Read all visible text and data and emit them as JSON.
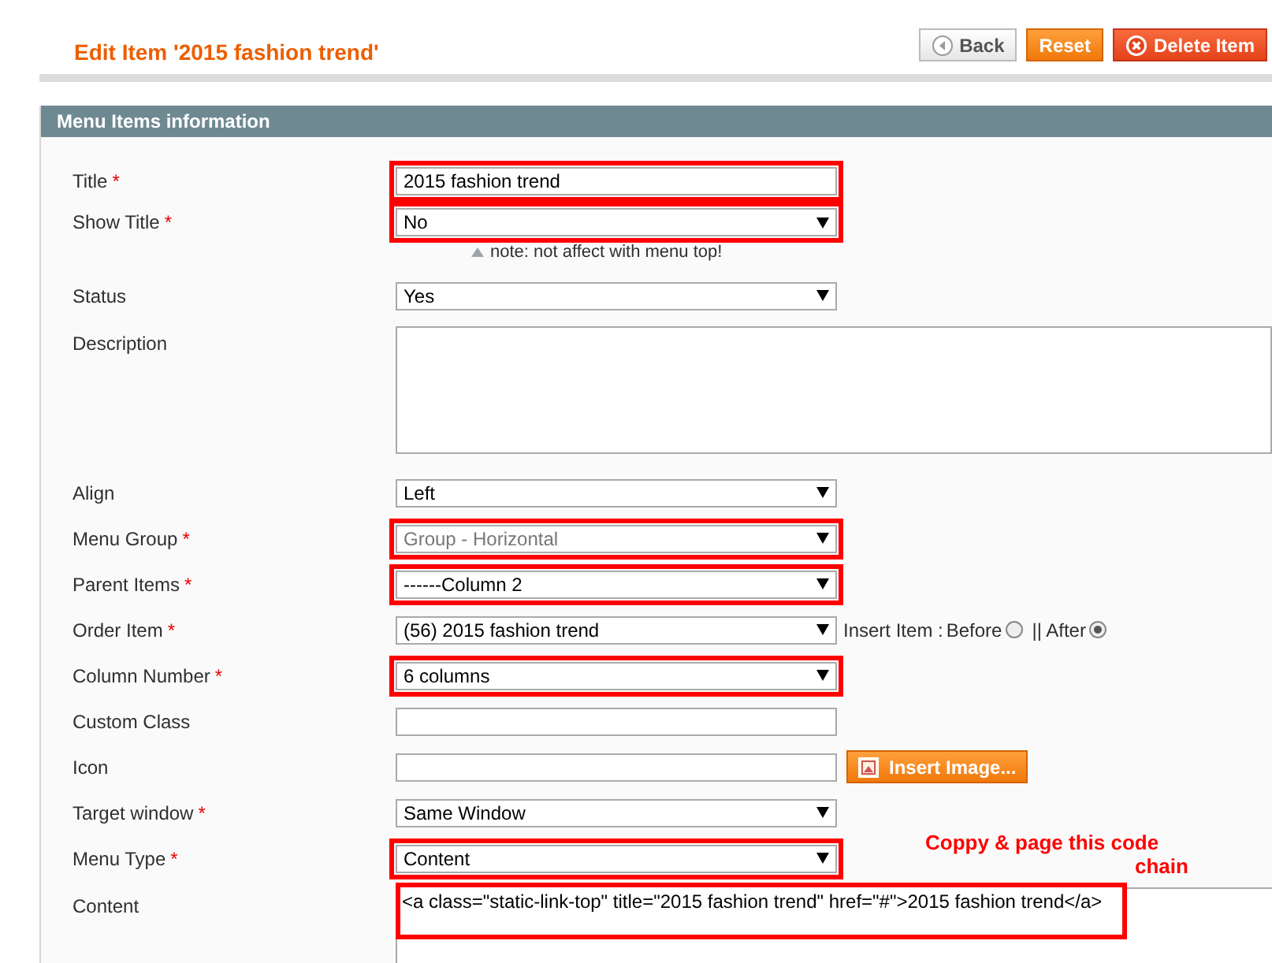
{
  "header": {
    "title": "Edit Item '2015 fashion trend'",
    "buttons": [
      {
        "label": "Back",
        "kind": "back"
      },
      {
        "label": "Reset",
        "kind": "reset"
      },
      {
        "label": "Delete Item",
        "kind": "delete"
      }
    ]
  },
  "panel": {
    "title": "Menu Items information",
    "fields": [
      {
        "label": "Title",
        "required_mark": "*",
        "kind": "text",
        "value": "2015 fashion trend",
        "highlighted": true
      },
      {
        "label": "Show Title",
        "required_mark": "*",
        "kind": "select",
        "value": "No",
        "highlighted": true,
        "note": "note: not affect with menu top!"
      },
      {
        "label": "Status",
        "kind": "select",
        "value": "Yes",
        "highlighted": false
      },
      {
        "label": "Description",
        "kind": "textarea",
        "highlighted": false
      },
      {
        "label": "Align",
        "kind": "select",
        "value": "Left",
        "highlighted": false
      },
      {
        "label": "Menu Group",
        "required_mark": "*",
        "kind": "select",
        "value": "Group - Horizontal",
        "disabled": true,
        "highlighted": true
      },
      {
        "label": "Parent Items",
        "required_mark": "*",
        "kind": "select",
        "value": "------Column 2",
        "highlighted": true
      },
      {
        "label": "Order Item",
        "required_mark": "*",
        "kind": "select",
        "value": "(56) 2015 fashion trend",
        "highlighted": false,
        "insert": {
          "label": "Insert Item :",
          "options": [
            {
              "label": "Before",
              "selected": false
            },
            {
              "label": "|| After",
              "selected": true
            }
          ]
        }
      },
      {
        "label": "Column Number",
        "required_mark": "*",
        "kind": "select",
        "value": "6 columns",
        "highlighted": true
      },
      {
        "label": "Custom Class",
        "kind": "text",
        "highlighted": false
      },
      {
        "label": "Icon",
        "kind": "text",
        "highlighted": false,
        "button": "Insert Image..."
      },
      {
        "label": "Target window",
        "required_mark": "*",
        "kind": "select",
        "value": "Same Window",
        "highlighted": false
      },
      {
        "label": "Menu Type",
        "required_mark": "*",
        "kind": "select",
        "value": "Content",
        "highlighted": true
      },
      {
        "label": "Content",
        "kind": "code",
        "value": "<a class=\"static-link-top\" title=\"2015 fashion trend\" href=\"#\">2015 fashion trend</a>",
        "highlighted": true
      }
    ],
    "annotation": [
      "Coppy & page this code",
      "chain"
    ]
  }
}
